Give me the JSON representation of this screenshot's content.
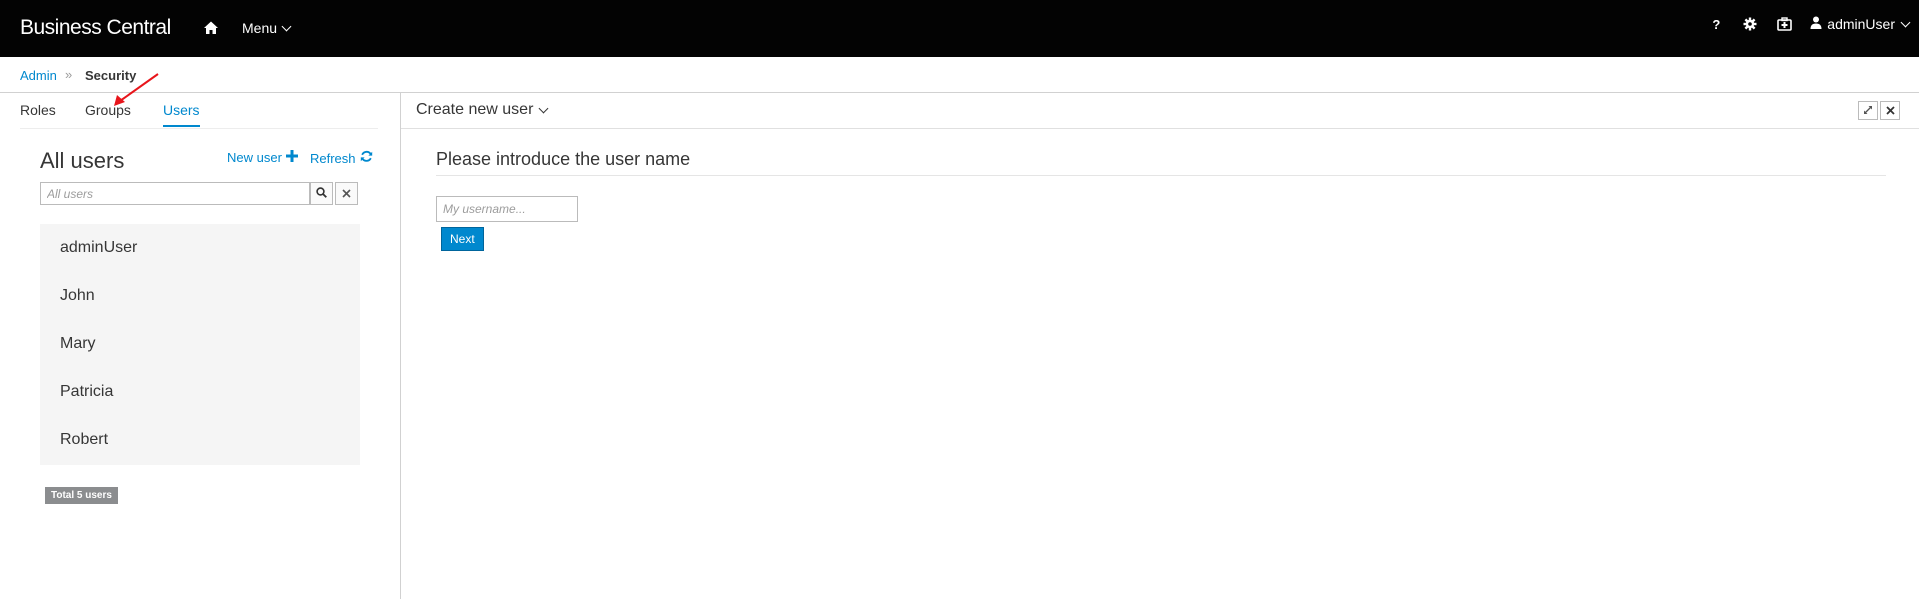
{
  "app": {
    "brand": "Business Central",
    "menu_label": "Menu",
    "user_label": "adminUser"
  },
  "breadcrumb": {
    "root": "Admin",
    "separator": "»",
    "current": "Security"
  },
  "tabs": [
    {
      "label": "Roles"
    },
    {
      "label": "Groups"
    },
    {
      "label": "Users",
      "active": true
    }
  ],
  "users_panel": {
    "title": "All users",
    "new_user_label": "New user",
    "refresh_label": "Refresh",
    "search_placeholder": "All users",
    "users": [
      "adminUser",
      "John",
      "Mary",
      "Patricia",
      "Robert"
    ],
    "total_label": "Total 5 users"
  },
  "create_panel": {
    "title": "Create new user",
    "heading": "Please introduce the user name",
    "username_placeholder": "My username...",
    "next_label": "Next"
  },
  "icons": {
    "home": "home-icon",
    "help": "question-icon",
    "settings": "gear-icon",
    "apps": "medkit-icon",
    "user": "user-icon",
    "new_user": "plus-icon",
    "refresh": "refresh-icon",
    "search": "search-icon",
    "clear": "close-icon",
    "maximize": "expand-icon",
    "close": "close-icon"
  },
  "colors": {
    "topbar": "#030303",
    "link": "#0088ce",
    "primary_button": "#0088ce",
    "list_background": "#f5f5f5",
    "total_badge": "#8b8d8f",
    "annotation_arrow": "#e8151b"
  }
}
